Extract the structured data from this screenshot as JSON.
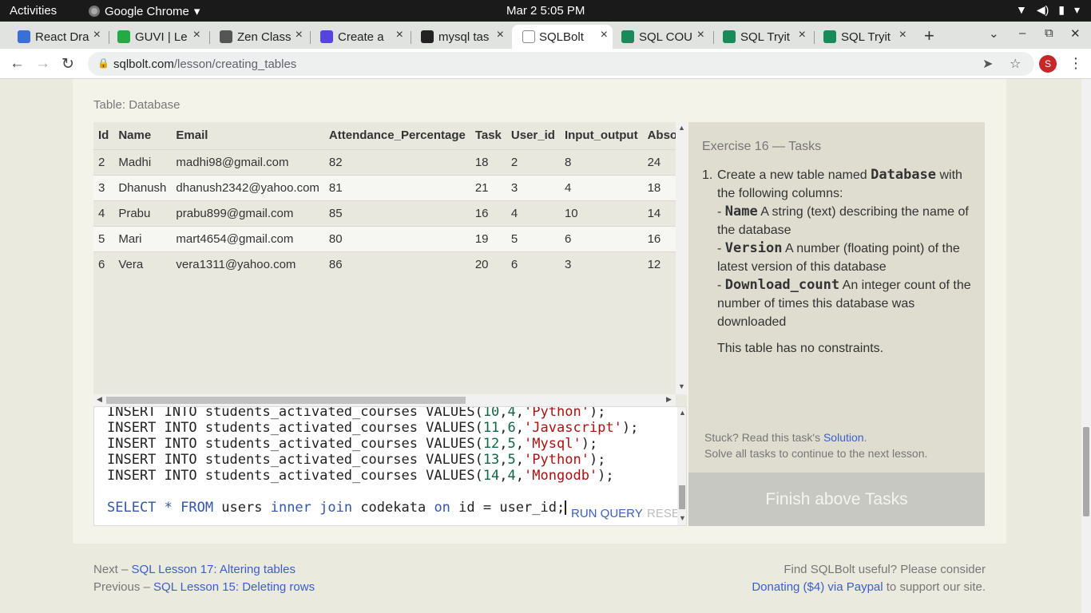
{
  "os": {
    "activities": "Activities",
    "app_name": "Google Chrome",
    "clock": "Mar 2  5:05 PM"
  },
  "tabs": [
    {
      "title": "React Dra",
      "icon_color": "#3a6fd8",
      "icon": "react-icon"
    },
    {
      "title": "GUVI | Le",
      "icon_color": "#22aa44",
      "icon": "guvi-icon"
    },
    {
      "title": "Zen Class",
      "icon_color": "#555555",
      "icon": "zen-icon"
    },
    {
      "title": "Create a",
      "icon_color": "#5544dd",
      "icon": "create-icon"
    },
    {
      "title": "mysql tas",
      "icon_color": "#222222",
      "icon": "github-icon"
    },
    {
      "title": "SQLBolt",
      "icon_color": "#555555",
      "icon": "database-icon"
    },
    {
      "title": "SQL COU",
      "icon_color": "#1a8a5a",
      "icon": "w3schools-icon"
    },
    {
      "title": "SQL Tryit",
      "icon_color": "#1a8a5a",
      "icon": "w3schools-icon"
    },
    {
      "title": "SQL Tryit",
      "icon_color": "#1a8a5a",
      "icon": "w3schools-icon"
    }
  ],
  "address": {
    "host": "sqlbolt.com",
    "path": "/lesson/creating_tables",
    "avatar_letter": "S"
  },
  "table": {
    "caption": "Table: Database",
    "columns": [
      "Id",
      "Name",
      "Email",
      "Attendance_Percentage",
      "Task",
      "User_id",
      "Input_output",
      "Absolute"
    ],
    "rows": [
      [
        "2",
        "Madhi",
        "madhi98@gmail.com",
        "82",
        "18",
        "2",
        "8",
        "24"
      ],
      [
        "3",
        "Dhanush",
        "dhanush2342@yahoo.com",
        "81",
        "21",
        "3",
        "4",
        "18"
      ],
      [
        "4",
        "Prabu",
        "prabu899@gmail.com",
        "85",
        "16",
        "4",
        "10",
        "14"
      ],
      [
        "5",
        "Mari",
        "mart4654@gmail.com",
        "80",
        "19",
        "5",
        "6",
        "16"
      ],
      [
        "6",
        "Vera",
        "vera1311@yahoo.com",
        "86",
        "20",
        "6",
        "3",
        "12"
      ]
    ]
  },
  "editor": {
    "lines": [
      {
        "pre": "INSERT INTO students_activated_courses VALUES(",
        "a": "10",
        "b": "4",
        "s": "'Python'",
        "post": ");"
      },
      {
        "pre": "INSERT INTO students_activated_courses VALUES(",
        "a": "11",
        "b": "6",
        "s": "'Javascript'",
        "post": ");"
      },
      {
        "pre": "INSERT INTO students_activated_courses VALUES(",
        "a": "12",
        "b": "5",
        "s": "'Mysql'",
        "post": ");"
      },
      {
        "pre": "INSERT INTO students_activated_courses VALUES(",
        "a": "13",
        "b": "5",
        "s": "'Python'",
        "post": ");"
      },
      {
        "pre": "INSERT INTO students_activated_courses VALUES(",
        "a": "14",
        "b": "4",
        "s": "'Mongodb'",
        "post": ");"
      }
    ],
    "query": {
      "p1": "SELECT * FROM ",
      "p2": "users ",
      "p3": "inner join ",
      "p4": "codekata ",
      "p5": "on ",
      "p6": "id = user_id;"
    },
    "run_label": "RUN QUERY",
    "reset_label": "RESET"
  },
  "task": {
    "title": "Exercise 16 — Tasks",
    "number": "1.",
    "intro_a": "Create a new table named ",
    "table_name": "Database",
    "intro_b": " with the following columns:",
    "columns": [
      {
        "name": "Name",
        "desc": " A string (text) describing the name of the database"
      },
      {
        "name": "Version",
        "desc": " A number (floating point) of the latest version of this database"
      },
      {
        "name": "Download_count",
        "desc": " An integer count of the number of times this database was downloaded"
      }
    ],
    "note": "This table has no constraints.",
    "stuck_a": "Stuck? Read this task's ",
    "solution": "Solution",
    "stuck_b": ".",
    "solve_all": "Solve all tasks to continue to the next lesson.",
    "finish": "Finish above Tasks"
  },
  "footer": {
    "next_prefix": "Next – ",
    "next_link": "SQL Lesson 17: Altering tables",
    "prev_prefix": "Previous – ",
    "prev_link": "SQL Lesson 15: Deleting rows",
    "useful": "Find SQLBolt useful? Please consider",
    "donate_link": "Donating ($4) via Paypal",
    "donate_suffix": " to support our site."
  }
}
